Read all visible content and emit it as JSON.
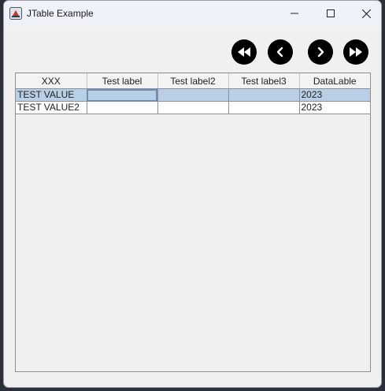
{
  "window": {
    "title": "JTable Example"
  },
  "nav": {
    "first_icon": "fast-backward-icon",
    "prev_icon": "chevron-left-icon",
    "next_icon": "chevron-right-icon",
    "last_icon": "fast-forward-icon"
  },
  "table": {
    "columns": [
      "XXX",
      "Test label",
      "Test label2",
      "Test label3",
      "DataLable"
    ],
    "rows": [
      [
        "TEST VALUE",
        "",
        "",
        "",
        "2023"
      ],
      [
        "TEST VALUE2",
        "",
        "",
        "",
        "2023"
      ]
    ],
    "selected_row": 0,
    "selection_color": "#b8cfe5"
  }
}
